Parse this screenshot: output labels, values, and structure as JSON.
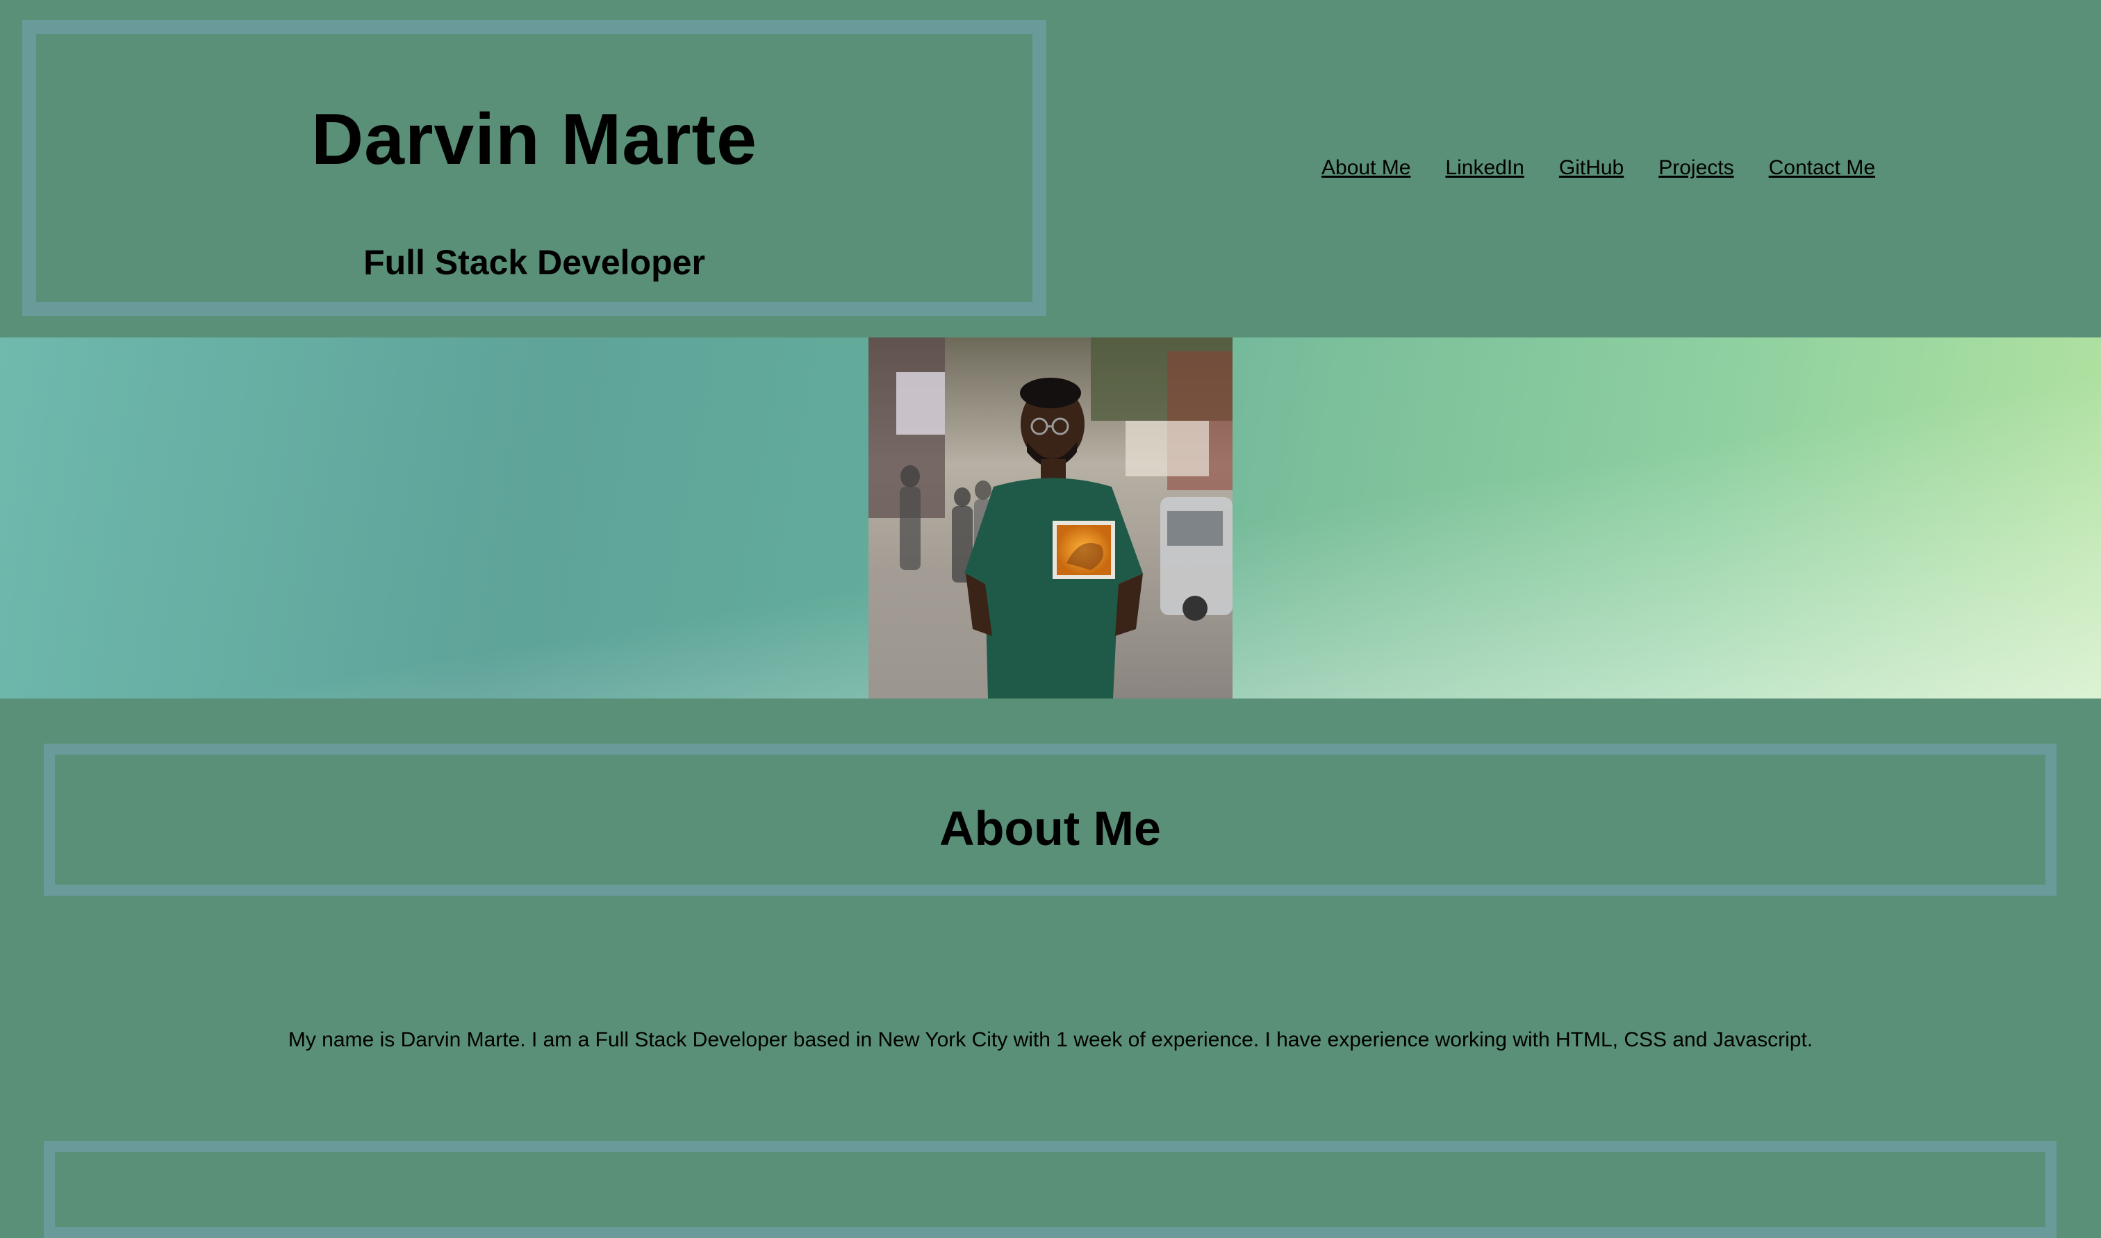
{
  "header": {
    "name": "Darvin Marte",
    "subtitle": "Full Stack Developer"
  },
  "nav": {
    "items": [
      {
        "label": "About Me"
      },
      {
        "label": "LinkedIn"
      },
      {
        "label": "GitHub"
      },
      {
        "label": "Projects"
      },
      {
        "label": "Contact Me"
      }
    ]
  },
  "hero": {
    "photo_icon": "profile-photo"
  },
  "about": {
    "title": "About Me",
    "text": "My name is Darvin Marte. I am a Full Stack Developer based in New York City with 1 week of experience. I have experience working with HTML, CSS and Javascript."
  },
  "colors": {
    "background": "#5a9077",
    "border": "#6b9a9b",
    "hero_left": "#6fb9ad",
    "hero_right": "#b3e3a0"
  }
}
